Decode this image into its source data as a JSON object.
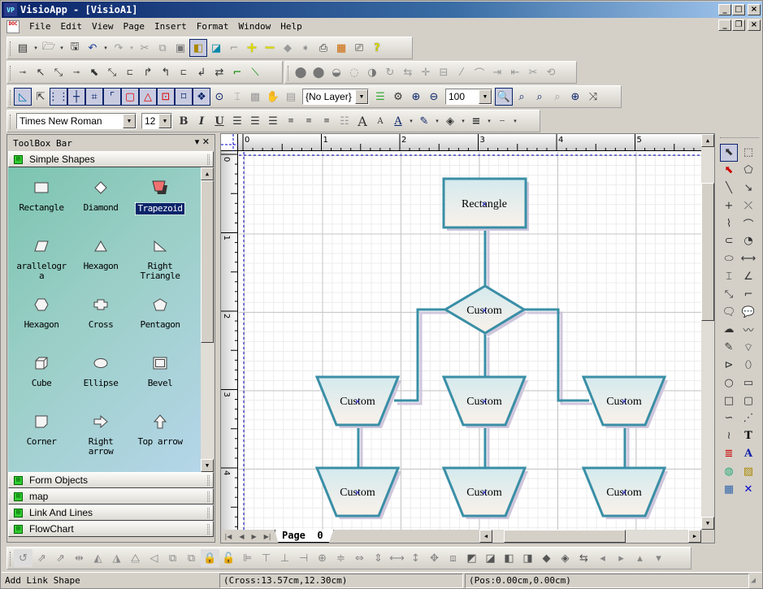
{
  "window": {
    "title": "VisioApp - [VisioA1]",
    "caption_buttons": [
      "_",
      "□",
      "×"
    ],
    "mdi_buttons": [
      "_",
      "❐",
      "×"
    ]
  },
  "menu": {
    "items": [
      "File",
      "Edit",
      "View",
      "Page",
      "Insert",
      "Format",
      "Window",
      "Help"
    ]
  },
  "toolbar_standard": {
    "icons": [
      "new-icon",
      "open-icon",
      "save-icon",
      "undo-icon",
      "redo-icon",
      "cut-icon",
      "copy-icon",
      "paste-icon",
      "format-painter-icon",
      "preview-icon",
      "ruler-icon",
      "add-icon",
      "remove-icon",
      "back-icon",
      "forward-icon",
      "print-icon",
      "color-grid-icon",
      "print-setup-icon",
      "help-icon"
    ]
  },
  "toolbar_links": {
    "icons": [
      "link-1-icon",
      "link-2-icon",
      "link-3-icon",
      "link-4-icon",
      "link-5-icon",
      "link-6-icon",
      "link-7-icon",
      "link-8-icon",
      "link-9-icon",
      "link-10-icon",
      "link-11-icon",
      "link-12-icon",
      "link-13-icon",
      "link-14-icon"
    ]
  },
  "toolbar_shapeops": {
    "icons": [
      "union-icon",
      "combine-icon",
      "fragment-icon",
      "intersect-icon",
      "subtract-icon",
      "rotate-icon",
      "reverse-icon",
      "add-point-icon",
      "remove-point-icon",
      "line-icon",
      "curve-icon",
      "align-left-icon",
      "align-right-icon",
      "cut-shape-icon",
      "join-icon"
    ]
  },
  "toolbar_view": {
    "layer_value": "{No Layer}",
    "zoom_value": "100"
  },
  "toolbar_format": {
    "font_value": "Times New Roman",
    "size_value": "12"
  },
  "toolbox": {
    "title": "ToolBox Bar",
    "active_group": "Simple Shapes",
    "shapes": [
      {
        "label": "Rectangle",
        "icon": "rectangle"
      },
      {
        "label": "Diamond",
        "icon": "diamond"
      },
      {
        "label": "Trapezoid",
        "icon": "trapezoid",
        "selected": true
      },
      {
        "label": "arallelogra",
        "icon": "parallelogram"
      },
      {
        "label": "Hexagon",
        "icon": "triangle"
      },
      {
        "label": "Right Triangle",
        "icon": "right-triangle"
      },
      {
        "label": "Hexagon",
        "icon": "hexagon"
      },
      {
        "label": "Cross",
        "icon": "cross"
      },
      {
        "label": "Pentagon",
        "icon": "pentagon"
      },
      {
        "label": "Cube",
        "icon": "cube"
      },
      {
        "label": "Ellipse",
        "icon": "ellipse"
      },
      {
        "label": "Bevel",
        "icon": "bevel"
      },
      {
        "label": "Corner",
        "icon": "corner"
      },
      {
        "label": "Right arrow",
        "icon": "right-arrow"
      },
      {
        "label": "Top arrow",
        "icon": "top-arrow"
      }
    ],
    "other_groups": [
      "Form Objects",
      "map",
      "Link And Lines",
      "FlowChart"
    ]
  },
  "ruler": {
    "h_labels": [
      "0",
      "1",
      "2",
      "3",
      "4",
      "5"
    ],
    "v_labels": [
      "0",
      "1",
      "2",
      "3",
      "4"
    ]
  },
  "diagram": {
    "colors": {
      "stroke": "#3a8fa6",
      "shadow": "#cfc6dc",
      "fill_top": "#d4eaee",
      "fill_bottom": "#faf1ea"
    },
    "nodes": [
      {
        "id": "rect",
        "type": "rectangle",
        "label": "Rectangle"
      },
      {
        "id": "diamond",
        "type": "diamond",
        "label": "Custom"
      },
      {
        "id": "t1",
        "type": "trapezoid",
        "label": "Custom"
      },
      {
        "id": "t2",
        "type": "trapezoid",
        "label": "Custom"
      },
      {
        "id": "t3",
        "type": "trapezoid",
        "label": "Custom"
      },
      {
        "id": "t4",
        "type": "trapezoid",
        "label": "Custom"
      },
      {
        "id": "t5",
        "type": "trapezoid",
        "label": "Custom"
      },
      {
        "id": "t6",
        "type": "trapezoid",
        "label": "Custom"
      }
    ]
  },
  "page_tabs": [
    "Page  0"
  ],
  "palette": {
    "icons": [
      "pointer-icon",
      "lasso-icon",
      "add-link-icon",
      "polyline-select-icon",
      "line-icon",
      "arrow-line-icon",
      "cross-icon",
      "bezier-icon",
      "polyline-icon",
      "arc-icon",
      "curve-icon",
      "pie-icon",
      "ellipse-icon",
      "h-dimension-icon",
      "v-dimension-icon",
      "angle-dimension-icon",
      "link-icon",
      "connector-icon",
      "callout-rect-icon",
      "callout-round-icon",
      "cloud-icon",
      "freehand-icon",
      "pen-icon",
      "polygon-icon",
      "chevron-icon",
      "rounded-ellipse-icon",
      "circle-icon",
      "rectangle-icon",
      "square-icon",
      "rounded-rect-icon",
      "blob-icon",
      "point-icon",
      "wave-icon",
      "text-icon",
      "rich-text-icon",
      "wordart-icon",
      "globe-icon",
      "image-icon",
      "table-icon",
      "delete-icon"
    ]
  },
  "toolbar_arrange": {
    "icons": [
      "rotate-free-icon",
      "rotate-left-icon",
      "rotate-right-icon",
      "flip-icon",
      "flip-h-icon",
      "flip-v-icon",
      "mirror-icon",
      "mirror2-icon",
      "group-icon",
      "ungroup-icon",
      "lock-icon",
      "unlock-icon",
      "align-left-icon",
      "align-top-icon",
      "align-bottom-icon",
      "align-right-icon",
      "center-h-icon",
      "center-v-icon",
      "space-h-icon",
      "space-v-icon",
      "same-width-icon",
      "same-height-icon",
      "same-size-icon",
      "distribute-icon",
      "bring-front-icon",
      "send-back-icon",
      "bring-forward-icon",
      "send-backward-icon",
      "order1-icon",
      "order2-icon",
      "swap-icon",
      "move-left-icon",
      "move-right-icon",
      "move-up-icon",
      "move-down-icon"
    ]
  },
  "status": {
    "message": "Add Link Shape",
    "cross": "(Cross:13.57cm,12.30cm)",
    "pos": "(Pos:0.00cm,0.00cm)"
  }
}
